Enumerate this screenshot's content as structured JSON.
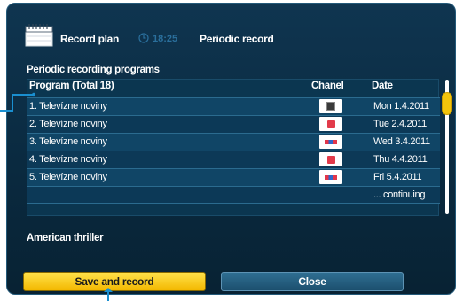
{
  "header": {
    "title": "Record plan",
    "time": "18:25",
    "mode": "Periodic record",
    "icon": "calendar-icon",
    "clock_icon": "clock-icon"
  },
  "section_title": "Periodic recording programs",
  "table": {
    "columns": {
      "program": "Program (Total 18)",
      "chanel": "Chanel",
      "date": "Date"
    },
    "rows": [
      {
        "name": "1. Televízne noviny",
        "logo": "dark-channel-logo",
        "date": "Mon 1.4.2011"
      },
      {
        "name": "2. Televízne noviny",
        "logo": "red-channel-logo",
        "date": "Tue 2.4.2011"
      },
      {
        "name": "3. Televízne noviny",
        "logo": "multicolor-channel-logo",
        "date": "Wed 3.4.2011"
      },
      {
        "name": "4. Televízne noviny",
        "logo": "red-channel-logo",
        "date": "Thu 4.4.2011"
      },
      {
        "name": "5. Televízne noviny",
        "logo": "multicolor-channel-logo",
        "date": "Fri 5.4.2011"
      }
    ],
    "continuing": "... continuing"
  },
  "description": "American thriller",
  "buttons": {
    "save": "Save and record",
    "close": "Close"
  },
  "colors": {
    "accent": "#f2c40c",
    "dialog_bg": "#0f3550",
    "pointer": "#1a8fd0",
    "time_text": "#2a6f9c"
  }
}
